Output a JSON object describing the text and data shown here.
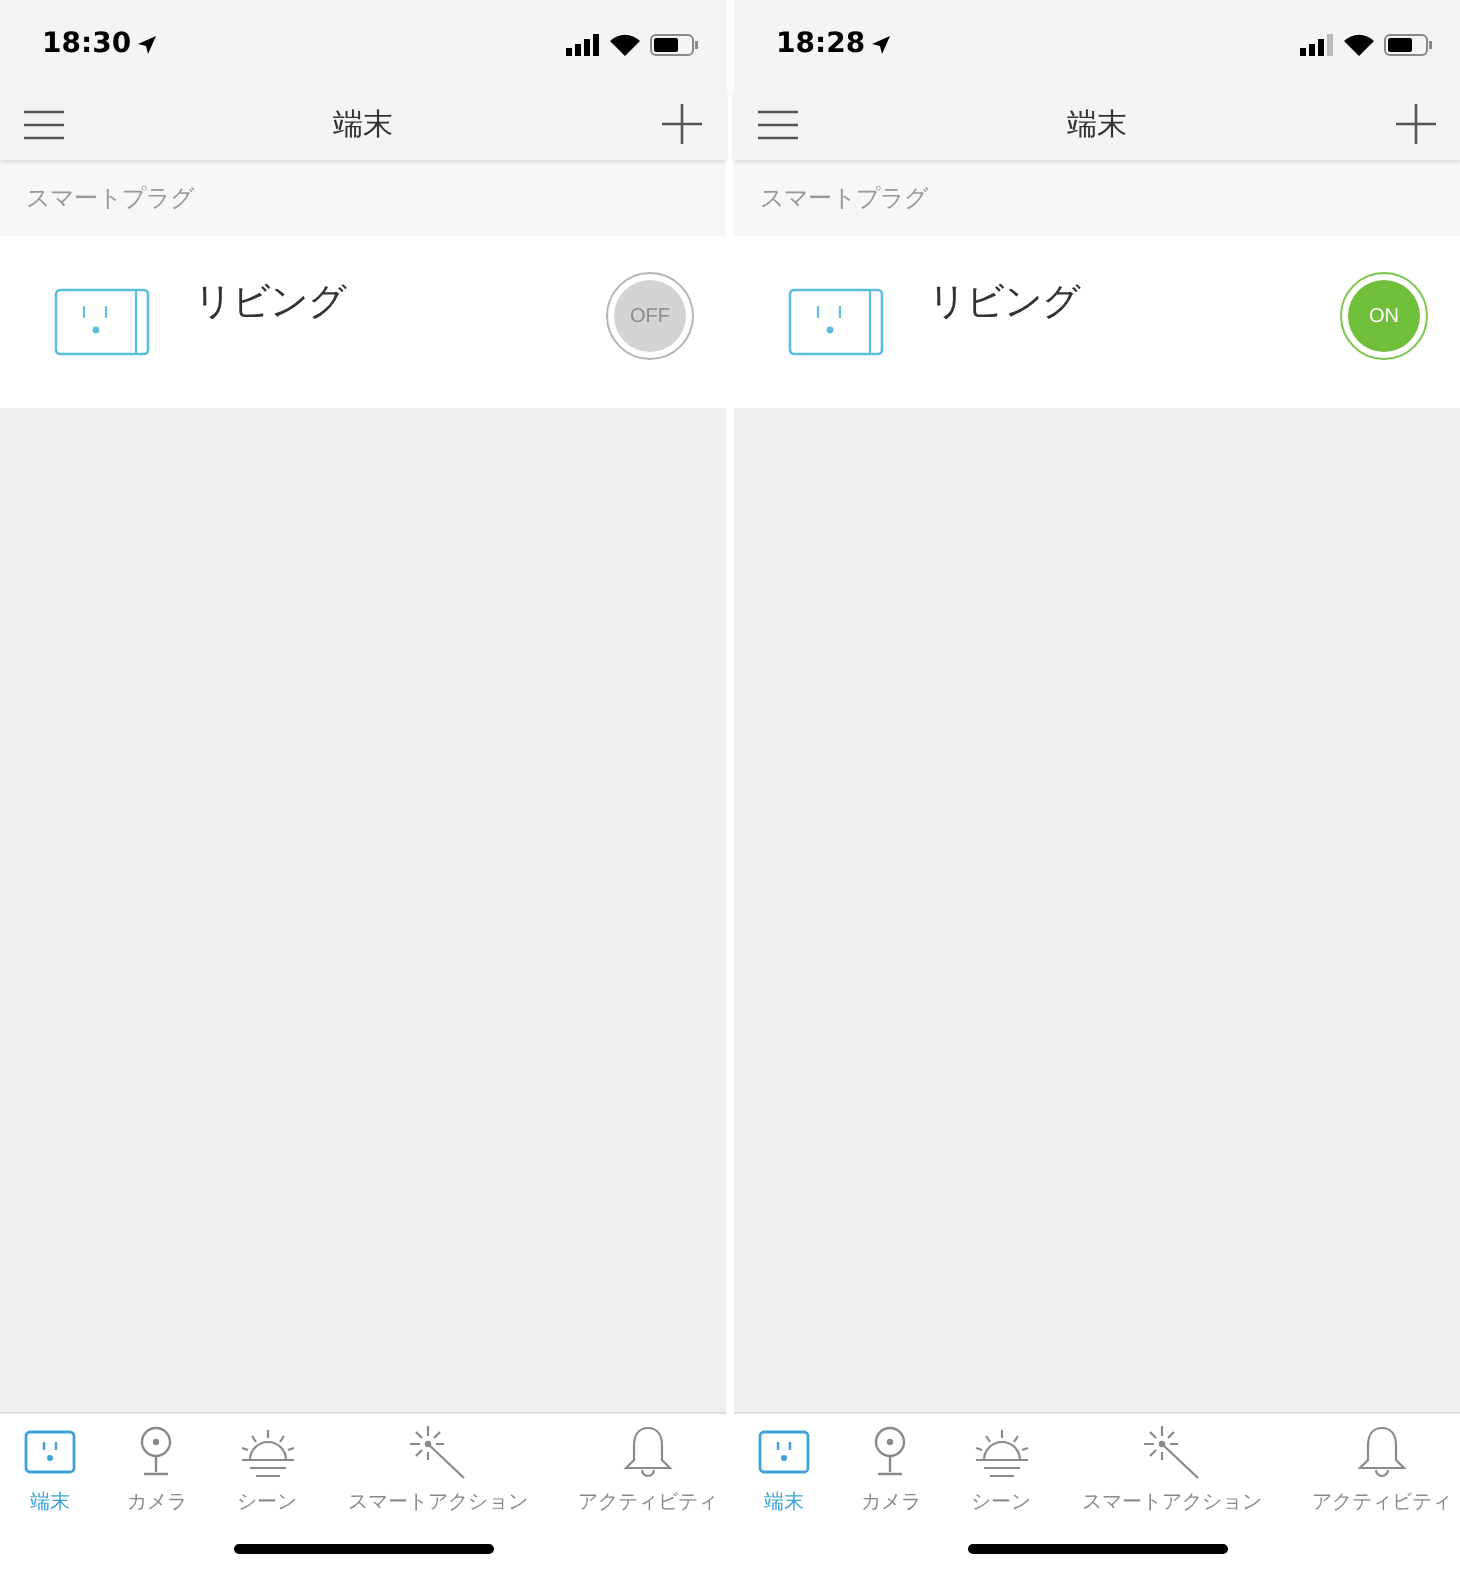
{
  "screens": [
    {
      "time": "18:30",
      "title": "端末",
      "section": "スマートプラグ",
      "device": {
        "name": "リビング",
        "on": false,
        "switch_label": "OFF"
      },
      "tabs": [
        {
          "kind": "plug",
          "label": "端末",
          "selected": true
        },
        {
          "kind": "camera",
          "label": "カメラ",
          "selected": false
        },
        {
          "kind": "scene",
          "label": "シーン",
          "selected": false
        },
        {
          "kind": "wand",
          "label": "スマートアクション",
          "selected": false
        },
        {
          "kind": "bell",
          "label": "アクティビティ",
          "selected": false
        }
      ]
    },
    {
      "time": "18:28",
      "title": "端末",
      "section": "スマートプラグ",
      "device": {
        "name": "リビング",
        "on": true,
        "switch_label": "ON"
      },
      "tabs": [
        {
          "kind": "plug",
          "label": "端末",
          "selected": true
        },
        {
          "kind": "camera",
          "label": "カメラ",
          "selected": false
        },
        {
          "kind": "scene",
          "label": "シーン",
          "selected": false
        },
        {
          "kind": "wand",
          "label": "スマートアクション",
          "selected": false
        },
        {
          "kind": "bell",
          "label": "アクティビティ",
          "selected": false
        }
      ]
    }
  ]
}
